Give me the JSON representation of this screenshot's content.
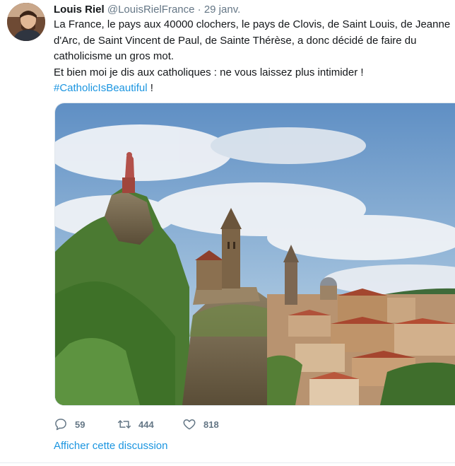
{
  "tweet": {
    "author_name": "Louis Riel",
    "handle": "@LouisRielFrance",
    "separator": "·",
    "date": "29 janv.",
    "text_line1": "La France, le pays aux 40000 clochers, le pays de Clovis, de Saint Louis, de Jeanne d'Arc, de Saint Vincent de Paul, de Sainte Thérèse, a donc décidé de faire du catholicisme un gros mot.",
    "text_line2": "Et bien moi je dis aux catholiques : ne vous laissez plus intimider !",
    "hashtag": "#CatholicIsBeautiful",
    "hashtag_suffix": " !",
    "media_description_icon": "photo-cliff-chapel-town",
    "actions": {
      "reply_count": "59",
      "retweet_count": "444",
      "like_count": "818"
    },
    "show_thread": "Afficher cette discussion"
  },
  "colors": {
    "link": "#1b95e0",
    "muted": "#657786",
    "text": "#14171a"
  }
}
